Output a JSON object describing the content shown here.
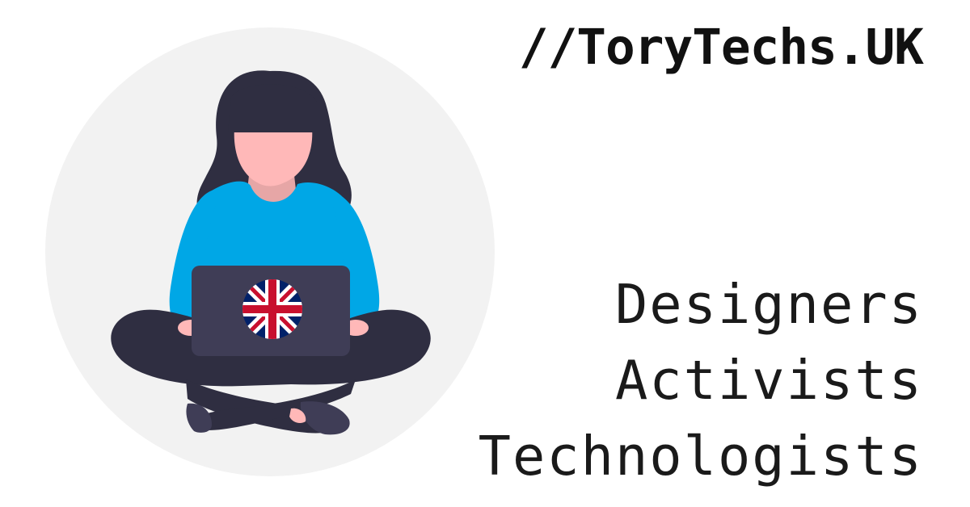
{
  "header": {
    "title": "//ToryTechs.UK"
  },
  "roles": [
    "Designers",
    "Activists",
    "Technologists"
  ],
  "illustration": {
    "subject": "person-with-laptop-illustration",
    "icon": "union-jack-icon",
    "colors": {
      "background_circle": "#f2f2f2",
      "hair": "#2f2e41",
      "skin": "#ffb8b8",
      "neck_shadow": "#e6a6a6",
      "sweater": "#00a7e6",
      "trousers": "#2f2e41",
      "laptop": "#3f3d56",
      "flag_blue": "#012169",
      "flag_red": "#c8102e",
      "flag_white": "#ffffff"
    }
  }
}
